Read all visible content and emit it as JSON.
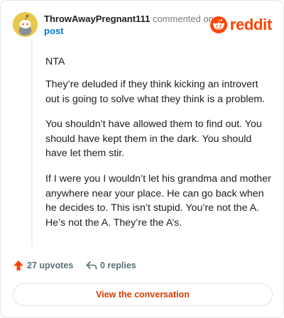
{
  "header": {
    "author": "ThrowAwayPregnant111",
    "commented_on": "commented on",
    "post_link": "post",
    "logo_text": "reddit"
  },
  "comment": {
    "paragraphs": [
      "NTA",
      "They’re deluded if they think kicking an introvert out is going to solve what they think is a problem.",
      "You shouldn’t have allowed them to find out. You should have kept them in the dark. You should have let them stir.",
      "If I were you I wouldn’t let his grandma and mother anywhere near your place. He can go back when he decides to. This isn’t stupid. You’re not the A. He’s not the A. They’re the A’s."
    ]
  },
  "footer": {
    "upvotes": "27 upvotes",
    "replies": "0 replies"
  },
  "cta": {
    "label": "View the conversation"
  },
  "colors": {
    "brand": "#ff4500",
    "link": "#0079d3",
    "cta_text": "#d93a00",
    "avatar_bg": "#e8c74a"
  },
  "icons": {
    "avatar": "snoo-avatar-icon",
    "logo": "reddit-logo-icon",
    "upvote": "upvote-arrow-icon",
    "reply": "reply-arrow-icon"
  }
}
